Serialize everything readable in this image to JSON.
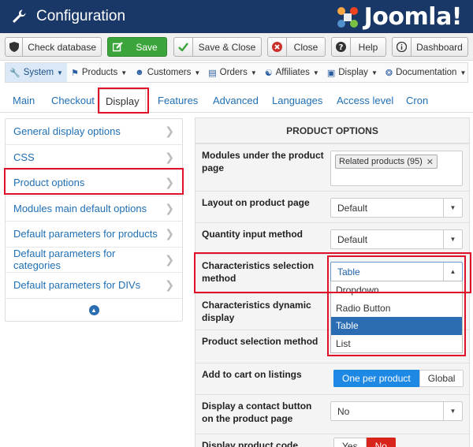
{
  "header": {
    "title": "Configuration",
    "logo_text": "Joomla!"
  },
  "toolbar": {
    "check_database": "Check database",
    "save": "Save",
    "save_close": "Save & Close",
    "close": "Close",
    "help": "Help",
    "dashboard": "Dashboard"
  },
  "submenu": {
    "system": "System",
    "products": "Products",
    "customers": "Customers",
    "orders": "Orders",
    "affiliates": "Affiliates",
    "display": "Display",
    "documentation": "Documentation"
  },
  "tabs": [
    "Main",
    "Checkout",
    "Display",
    "Features",
    "Advanced",
    "Languages",
    "Access level",
    "Cron"
  ],
  "left_menu": [
    "General display options",
    "CSS",
    "Product options",
    "Modules main default options",
    "Default parameters for products",
    "Default parameters for categories",
    "Default parameters for DIVs"
  ],
  "panel": {
    "heading": "PRODUCT OPTIONS",
    "modules_label": "Modules under the product page",
    "modules_tag": "Related products (95)",
    "layout_label": "Layout on product page",
    "layout_value": "Default",
    "quantity_label": "Quantity input method",
    "quantity_value": "Default",
    "characteristics_label": "Characteristics selection method",
    "characteristics_value": "Table",
    "characteristics_options": [
      "Dropdown",
      "Radio Button",
      "Table",
      "List"
    ],
    "dynamic_label": "Characteristics dynamic display",
    "selection_label": "Product selection method",
    "add_to_cart_label": "Add to cart on listings",
    "add_to_cart_options": [
      "One per product",
      "Global"
    ],
    "contact_label": "Display a contact button on the product page",
    "contact_value": "No",
    "code_label": "Display product code",
    "code_options": [
      "Yes",
      "No"
    ]
  },
  "colors": {
    "header_bg": "#1a3867",
    "save_green": "#3ba53b",
    "link_blue": "#1f6fb5",
    "highlight_red": "#e0102a",
    "selected_option": "#2b6db3"
  }
}
